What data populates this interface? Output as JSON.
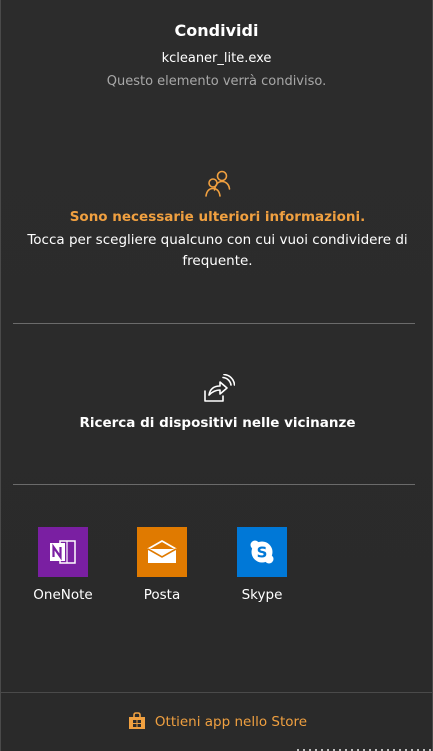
{
  "header": {
    "title": "Condividi",
    "filename": "kcleaner_lite.exe",
    "subtitle": "Questo elemento verrà condiviso."
  },
  "people": {
    "icon": "people-icon",
    "warning": "Sono necessarie ulteriori informazioni.",
    "description": "Tocca per scegliere qualcuno con cui vuoi condividere di frequente."
  },
  "nearby": {
    "icon": "nearby-share-icon",
    "label": "Ricerca di dispositivi nelle vicinanze"
  },
  "apps": [
    {
      "label": "OneNote",
      "icon": "onenote-icon",
      "color": "#7a1fa2"
    },
    {
      "label": "Posta",
      "icon": "mail-icon",
      "color": "#e07a00"
    },
    {
      "label": "Skype",
      "icon": "skype-icon",
      "color": "#0078d7"
    }
  ],
  "store": {
    "icon": "store-bag-icon",
    "label": "Ottieni app nello Store"
  },
  "colors": {
    "accent": "#f0a040",
    "background": "#2b2b2b",
    "subtle_text": "#a8a8a8"
  }
}
